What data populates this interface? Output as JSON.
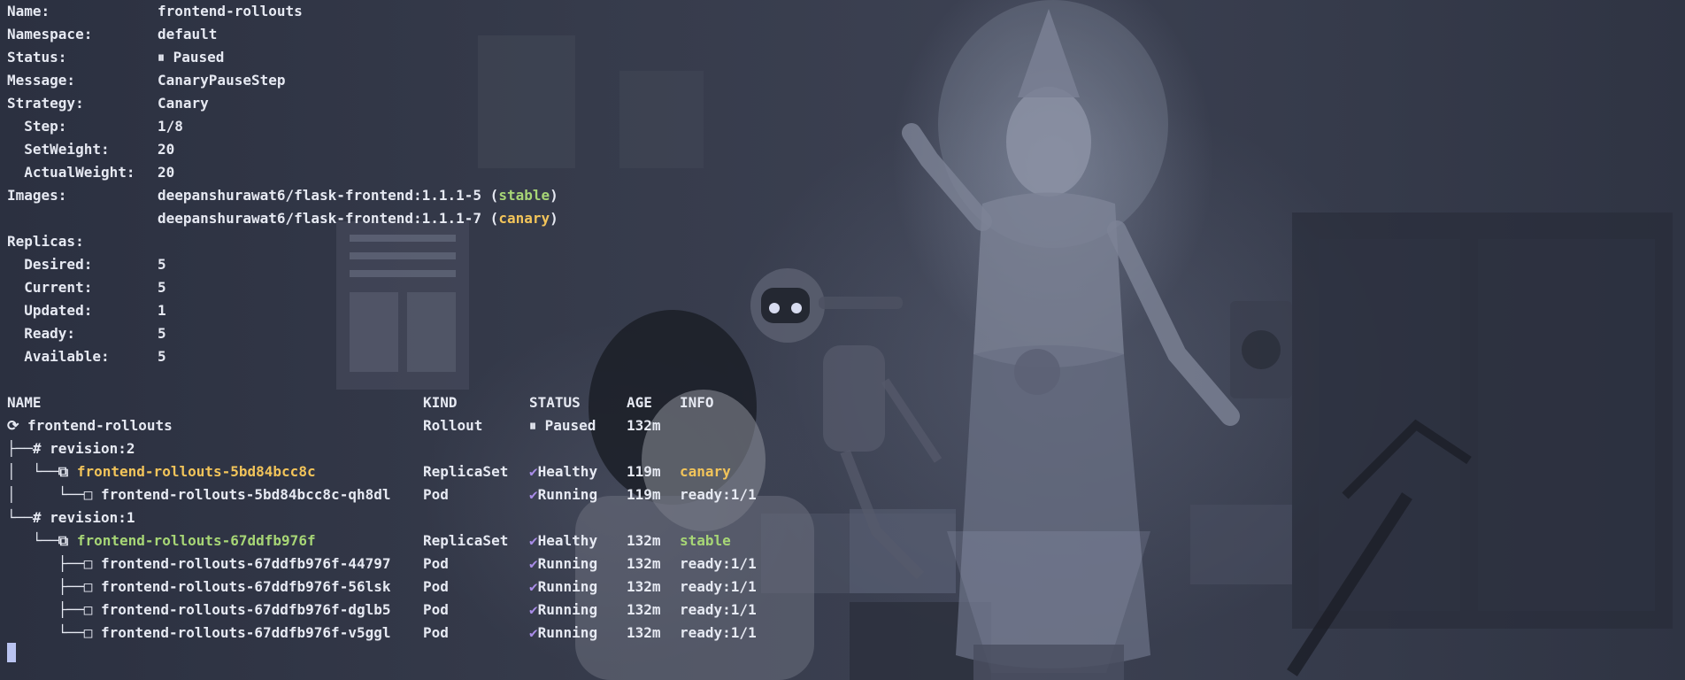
{
  "details": {
    "name_label": "Name:",
    "name_value": "frontend-rollouts",
    "namespace_label": "Namespace:",
    "namespace_value": "default",
    "status_label": "Status:",
    "status_value": "⏸ Paused",
    "message_label": "Message:",
    "message_value": "CanaryPauseStep",
    "strategy_label": "Strategy:",
    "strategy_value": "Canary",
    "step_label": "  Step:",
    "step_value": "1/8",
    "setweight_label": "  SetWeight:",
    "setweight_value": "20",
    "actualweight_label": "  ActualWeight:",
    "actualweight_value": "20",
    "images_label": "Images:",
    "image1": "deepanshurawat6/flask-frontend:1.1.1-5 (",
    "image1_tag": "stable",
    "image1_end": ")",
    "image2": "deepanshurawat6/flask-frontend:1.1.1-7 (",
    "image2_tag": "canary",
    "image2_end": ")",
    "replicas_label": "Replicas:",
    "desired_label": "  Desired:",
    "desired_value": "5",
    "current_label": "  Current:",
    "current_value": "5",
    "updated_label": "  Updated:",
    "updated_value": "1",
    "ready_label": "  Ready:",
    "ready_value": "5",
    "available_label": "  Available:",
    "available_value": "5"
  },
  "table": {
    "headers": {
      "name": "NAME",
      "kind": "KIND",
      "status": "STATUS",
      "age": "AGE",
      "info": "INFO"
    },
    "rows": [
      {
        "prefix": "⟳ ",
        "name": "frontend-rollouts",
        "kind": "Rollout",
        "status_icon": "",
        "status": "⏸ Paused",
        "age": "132m",
        "info": ""
      },
      {
        "prefix": "├──# ",
        "name": "revision:2",
        "kind": "",
        "status_icon": "",
        "status": "",
        "age": "",
        "info": ""
      },
      {
        "prefix": "│  └──⧉ ",
        "name": "frontend-rollouts-5bd84bcc8c",
        "kind": "ReplicaSet",
        "status_icon": "✔",
        "status": "Healthy",
        "age": "119m",
        "info": "canary"
      },
      {
        "prefix": "│     └──□ ",
        "name": "frontend-rollouts-5bd84bcc8c-qh8dl",
        "kind": "Pod",
        "status_icon": "✔",
        "status": "Running",
        "age": "119m",
        "info": "ready:1/1"
      },
      {
        "prefix": "└──# ",
        "name": "revision:1",
        "kind": "",
        "status_icon": "",
        "status": "",
        "age": "",
        "info": ""
      },
      {
        "prefix": "   └──⧉ ",
        "name": "frontend-rollouts-67ddfb976f",
        "kind": "ReplicaSet",
        "status_icon": "✔",
        "status": "Healthy",
        "age": "132m",
        "info": "stable"
      },
      {
        "prefix": "      ├──□ ",
        "name": "frontend-rollouts-67ddfb976f-44797",
        "kind": "Pod",
        "status_icon": "✔",
        "status": "Running",
        "age": "132m",
        "info": "ready:1/1"
      },
      {
        "prefix": "      ├──□ ",
        "name": "frontend-rollouts-67ddfb976f-56lsk",
        "kind": "Pod",
        "status_icon": "✔",
        "status": "Running",
        "age": "132m",
        "info": "ready:1/1"
      },
      {
        "prefix": "      ├──□ ",
        "name": "frontend-rollouts-67ddfb976f-dglb5",
        "kind": "Pod",
        "status_icon": "✔",
        "status": "Running",
        "age": "132m",
        "info": "ready:1/1"
      },
      {
        "prefix": "      └──□ ",
        "name": "frontend-rollouts-67ddfb976f-v5ggl",
        "kind": "Pod",
        "status_icon": "✔",
        "status": "Running",
        "age": "132m",
        "info": "ready:1/1"
      }
    ]
  },
  "colors": {
    "stable": "#a7d676",
    "canary": "#f2c45a",
    "check": "#a98ce8"
  }
}
